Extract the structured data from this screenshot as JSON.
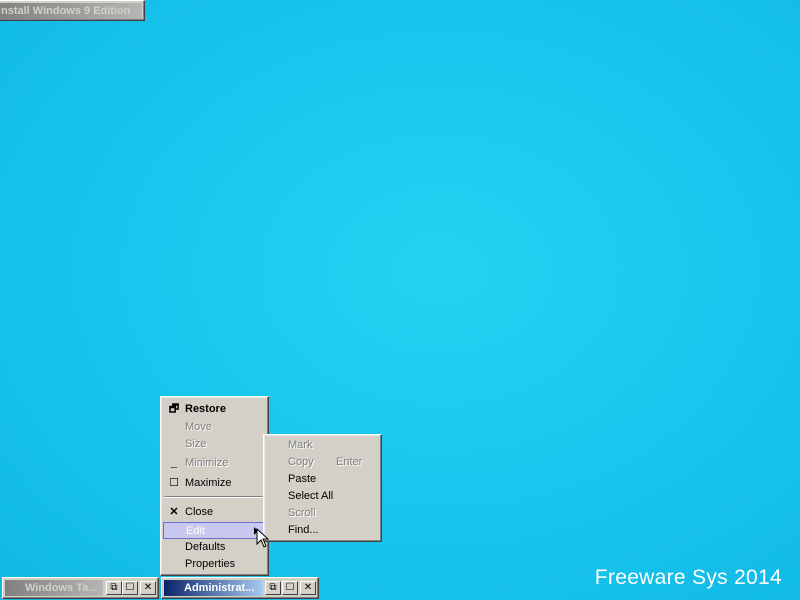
{
  "desktop": {
    "background_color": "#1ec6ee",
    "watermark": "Freeware Sys 2014"
  },
  "minimized_top": {
    "title": "nstall Windows 9 Edition"
  },
  "minimized_windows": [
    {
      "title": "Windows Ta...",
      "state": "inactive",
      "buttons": [
        "⧉",
        "☐",
        "✕"
      ]
    },
    {
      "title": "Administrat...",
      "state": "active",
      "buttons": [
        "⧉",
        "☐",
        "✕"
      ]
    }
  ],
  "system_menu": {
    "items": [
      {
        "label": "Restore",
        "icon": "restore-icon",
        "icon_glyph": "🗗",
        "bold": true
      },
      {
        "label": "Move",
        "disabled": true
      },
      {
        "label": "Size",
        "disabled": true
      },
      {
        "label": "Minimize",
        "icon": "minimize-icon",
        "icon_glyph": "_",
        "disabled": true
      },
      {
        "label": "Maximize",
        "icon": "maximize-icon",
        "icon_glyph": "☐"
      },
      {
        "label": "Close",
        "icon": "close-icon",
        "icon_glyph": "✕"
      },
      {
        "label": "Edit",
        "highlighted": true,
        "has_submenu": true
      },
      {
        "label": "Defaults"
      },
      {
        "label": "Properties"
      }
    ]
  },
  "edit_submenu": {
    "items": [
      {
        "label": "Mark",
        "disabled": true
      },
      {
        "label": "Copy",
        "shortcut": "Enter",
        "disabled": true
      },
      {
        "label": "Paste"
      },
      {
        "label": "Select All"
      },
      {
        "label": "Scroll",
        "disabled": true
      },
      {
        "label": "Find..."
      }
    ]
  },
  "colors": {
    "menu_bg": "#d4d0c8",
    "active_title": "#0a246a",
    "highlight": "#c8c8f0"
  }
}
